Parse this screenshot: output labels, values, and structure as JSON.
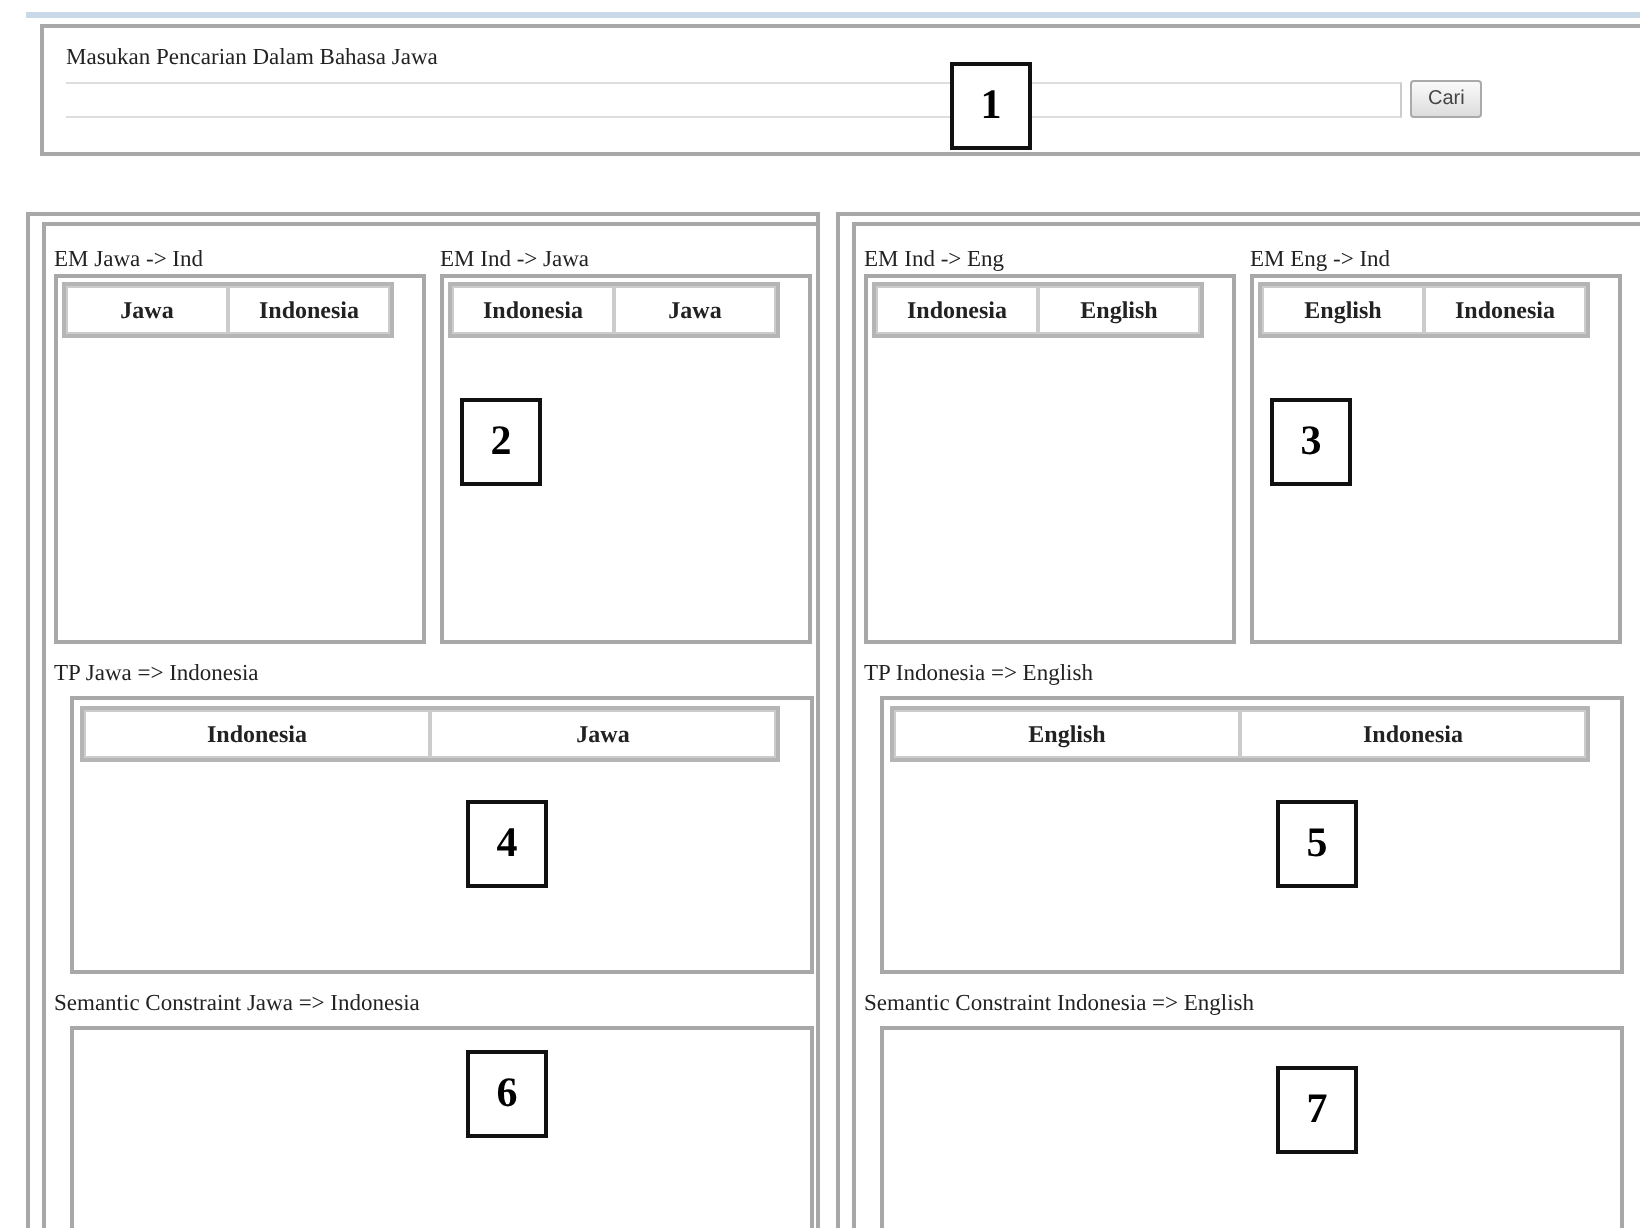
{
  "search": {
    "label": "Masukan Pencarian Dalam Bahasa Jawa",
    "button": "Cari",
    "callout": "1"
  },
  "panels": [
    {
      "em_tables": [
        {
          "title": "EM Jawa -> Ind",
          "columns": [
            "Jawa",
            "Indonesia"
          ]
        },
        {
          "title": "EM Ind -> Jawa",
          "columns": [
            "Indonesia",
            "Jawa"
          ],
          "callout": "2"
        }
      ],
      "tp": {
        "title": "TP Jawa => Indonesia",
        "columns": [
          "Indonesia",
          "Jawa"
        ],
        "callout": "4"
      },
      "semantic": {
        "title": "Semantic Constraint Jawa => Indonesia",
        "callout": "6"
      }
    },
    {
      "em_tables": [
        {
          "title": "EM Ind -> Eng",
          "columns": [
            "Indonesia",
            "English"
          ]
        },
        {
          "title": "EM Eng -> Ind",
          "columns": [
            "English",
            "Indonesia"
          ],
          "callout": "3"
        }
      ],
      "tp": {
        "title": "TP Indonesia => English",
        "columns": [
          "English",
          "Indonesia"
        ],
        "callout": "5"
      },
      "semantic": {
        "title": "Semantic Constraint Indonesia => English",
        "callout": "7"
      }
    }
  ]
}
